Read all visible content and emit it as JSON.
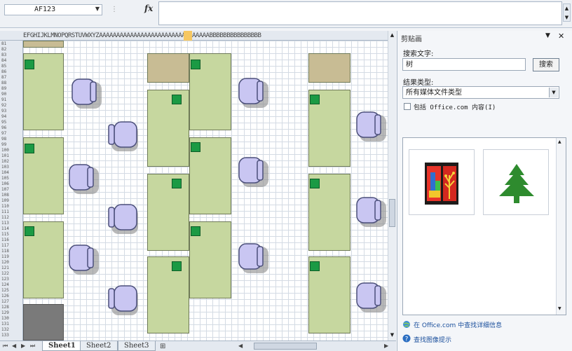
{
  "formula_bar": {
    "name_box_value": "AF123",
    "fx_label": "fx",
    "formula_value": ""
  },
  "columns_header_text": "EFGHIJKLMNOPQRSTUVWXYZAAAAAAAAAAAAAAAAAAAAAAAAAAAAAAAABBBBBBBBBBBBBBB",
  "rows": [
    "81",
    "82",
    "83",
    "84",
    "85",
    "86",
    "87",
    "88",
    "89",
    "90",
    "91",
    "92",
    "93",
    "94",
    "95",
    "96",
    "97",
    "98",
    "99",
    "100",
    "101",
    "102",
    "103",
    "104",
    "105",
    "106",
    "107",
    "108",
    "109",
    "110",
    "111",
    "112",
    "113",
    "114",
    "115",
    "116",
    "117",
    "118",
    "119",
    "120",
    "121",
    "122",
    "123",
    "124",
    "125",
    "126",
    "127",
    "128",
    "129",
    "130",
    "131",
    "132",
    "133"
  ],
  "sheet_tabs": [
    "Sheet1",
    "Sheet2",
    "Sheet3"
  ],
  "active_sheet": "Sheet1",
  "task_pane": {
    "title": "剪贴画",
    "search_label": "搜索文字:",
    "search_value": "树",
    "search_button": "搜索",
    "result_label": "结果类型:",
    "result_value": "所有媒体文件类型",
    "include_label": "包括 Office.com 内容(I)",
    "include_checked": false,
    "results": [
      {
        "icon": "colorful-tree-painting-clipart"
      },
      {
        "icon": "green-pine-tree-clipart"
      }
    ],
    "footer_link_1": "在 Office.com 中查找详细信息",
    "footer_link_2": "查找图像提示"
  },
  "colors": {
    "desk_green": "#c6d79f",
    "desk_tan": "#c8bc94",
    "marker_green": "#1b9a44",
    "chair_lavender": "#c9c6f2",
    "column_highlight": "#f6c761"
  }
}
